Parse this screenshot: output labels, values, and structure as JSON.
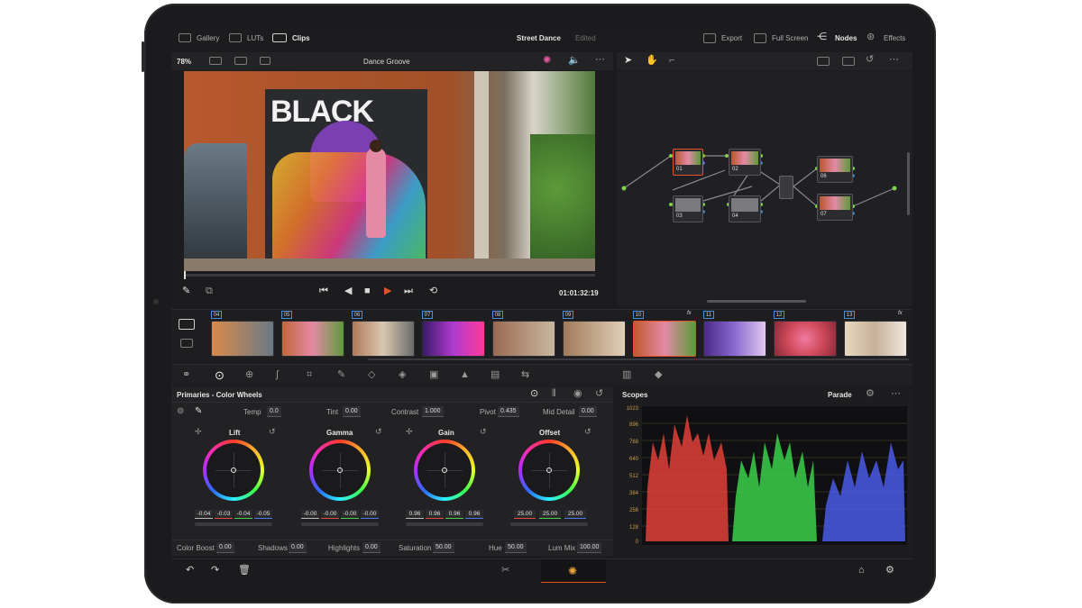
{
  "topbar": {
    "gallery_label": "Gallery",
    "luts_label": "LUTs",
    "clips_label": "Clips",
    "project_title": "Street Dance",
    "edited_label": "Edited",
    "export_label": "Export",
    "fullscreen_label": "Full Screen",
    "nodes_label": "Nodes",
    "effects_label": "Effects"
  },
  "viewer": {
    "zoom": "78%",
    "clip_name": "Dance Groove",
    "timecode": "01:01:32:19",
    "wall_text": "BLACK"
  },
  "nodes": [
    {
      "label": "01"
    },
    {
      "label": "02"
    },
    {
      "label": "03"
    },
    {
      "label": "04"
    },
    {
      "label": "06"
    },
    {
      "label": "07"
    }
  ],
  "timeline": {
    "clips": [
      {
        "num": "04",
        "color": "#d98a4a",
        "fx": ""
      },
      {
        "num": "05",
        "color": "#c2673a",
        "fx": ""
      },
      {
        "num": "06",
        "color": "#b07a5a",
        "fx": ""
      },
      {
        "num": "07",
        "color": "#b03ad0",
        "fx": ""
      },
      {
        "num": "08",
        "color": "#9a6a52",
        "fx": ""
      },
      {
        "num": "09",
        "color": "#a07a5a",
        "fx": ""
      },
      {
        "num": "10",
        "color": "#c0582e",
        "fx": "fx"
      },
      {
        "num": "11",
        "color": "#8a6ad0",
        "fx": ""
      },
      {
        "num": "12",
        "color": "#d04a5a",
        "fx": ""
      },
      {
        "num": "13",
        "color": "#c6b09a",
        "fx": "fx"
      }
    ]
  },
  "primaries": {
    "title": "Primaries - Color Wheels",
    "params": [
      {
        "label": "Temp",
        "value": "0.0"
      },
      {
        "label": "Tint",
        "value": "0.00"
      },
      {
        "label": "Contrast",
        "value": "1.000"
      },
      {
        "label": "Pivot",
        "value": "0.435"
      },
      {
        "label": "Mid Detail",
        "value": "0.00"
      }
    ],
    "wheels": [
      {
        "name": "Lift",
        "values": [
          "-0.04",
          "-0.03",
          "-0.04",
          "-0.05"
        ]
      },
      {
        "name": "Gamma",
        "values": [
          "-0.00",
          "-0.00",
          "-0.00",
          "-0.00"
        ]
      },
      {
        "name": "Gain",
        "values": [
          "0.96",
          "0.96",
          "0.96",
          "0.96"
        ]
      },
      {
        "name": "Offset",
        "values": [
          "25.00",
          "25.00",
          "25.00"
        ]
      }
    ],
    "bottom_params": [
      {
        "label": "Color Boost",
        "value": "0.00"
      },
      {
        "label": "Shadows",
        "value": "0.00"
      },
      {
        "label": "Highlights",
        "value": "0.00"
      },
      {
        "label": "Saturation",
        "value": "50.00"
      },
      {
        "label": "Hue",
        "value": "50.00"
      },
      {
        "label": "Lum Mix",
        "value": "100.00"
      }
    ]
  },
  "scopes": {
    "title": "Scopes",
    "mode": "Parade",
    "scale": [
      "1023",
      "896",
      "768",
      "640",
      "512",
      "384",
      "256",
      "128",
      "0"
    ]
  },
  "colors": {
    "accent": "#e8522a",
    "node_link": "#7fd04a",
    "clip_select": "#4a90d9"
  }
}
